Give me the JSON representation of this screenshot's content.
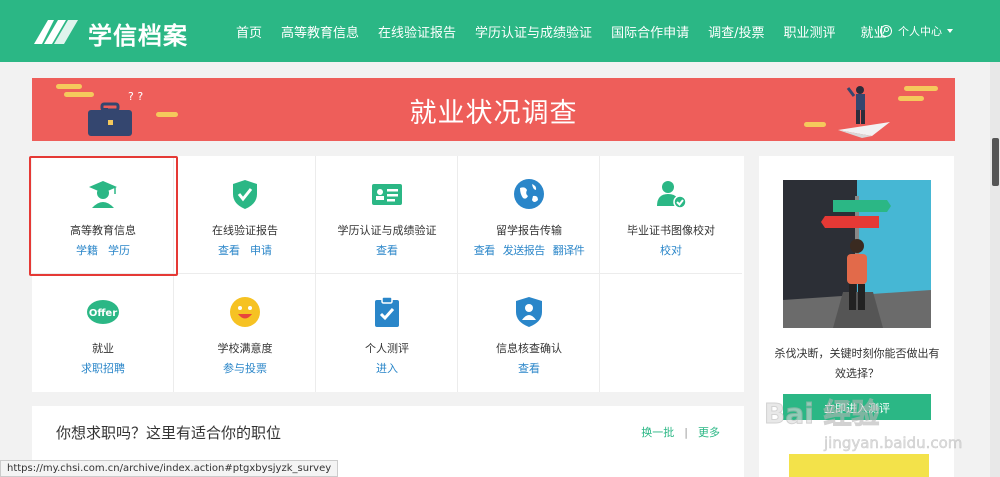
{
  "header": {
    "brand": "学信档案",
    "nav": [
      "首页",
      "高等教育信息",
      "在线验证报告",
      "学历认证与成绩验证",
      "国际合作申请",
      "调查/投票",
      "职业测评",
      "就业"
    ],
    "user_center": "个人中心",
    "colors": {
      "header_bg": "#2bb785"
    }
  },
  "banner": {
    "title": "就业状况调查",
    "colors": {
      "bg": "#ee5e5a",
      "deco": "#f5c95c"
    }
  },
  "services": [
    {
      "name": "高等教育信息",
      "links": [
        "学籍",
        "学历"
      ],
      "icon": "graduate-icon"
    },
    {
      "name": "在线验证报告",
      "links": [
        "查看",
        "申请"
      ],
      "icon": "shield-check-icon"
    },
    {
      "name": "学历认证与成绩验证",
      "links": [
        "查看"
      ],
      "icon": "id-card-icon"
    },
    {
      "name": "留学报告传输",
      "links": [
        "查看",
        "发送报告",
        "翻译件"
      ],
      "icon": "globe-icon"
    },
    {
      "name": "毕业证书图像校对",
      "links": [
        "校对"
      ],
      "icon": "user-check-icon"
    },
    {
      "name": "就业",
      "links": [
        "求职招聘"
      ],
      "icon": "offer-icon"
    },
    {
      "name": "学校满意度",
      "links": [
        "参与投票"
      ],
      "icon": "smiley-icon"
    },
    {
      "name": "个人测评",
      "links": [
        "进入"
      ],
      "icon": "clipboard-check-icon"
    },
    {
      "name": "信息核查确认",
      "links": [
        "查看"
      ],
      "icon": "user-shield-icon"
    }
  ],
  "side_ad": {
    "text": "杀伐决断，关键时刻你能否做出有效选择？",
    "button": "立即进入测评"
  },
  "job_section": {
    "title": "你想求职吗？这里有适合你的职位",
    "refresh": "换一批",
    "more": "更多"
  },
  "status_bar": "https://my.chsi.com.cn/archive/index.action#ptgxbysjyzk_survey",
  "watermark": {
    "main": "Bai 经验",
    "sub": "jingyan.baidu.com"
  }
}
